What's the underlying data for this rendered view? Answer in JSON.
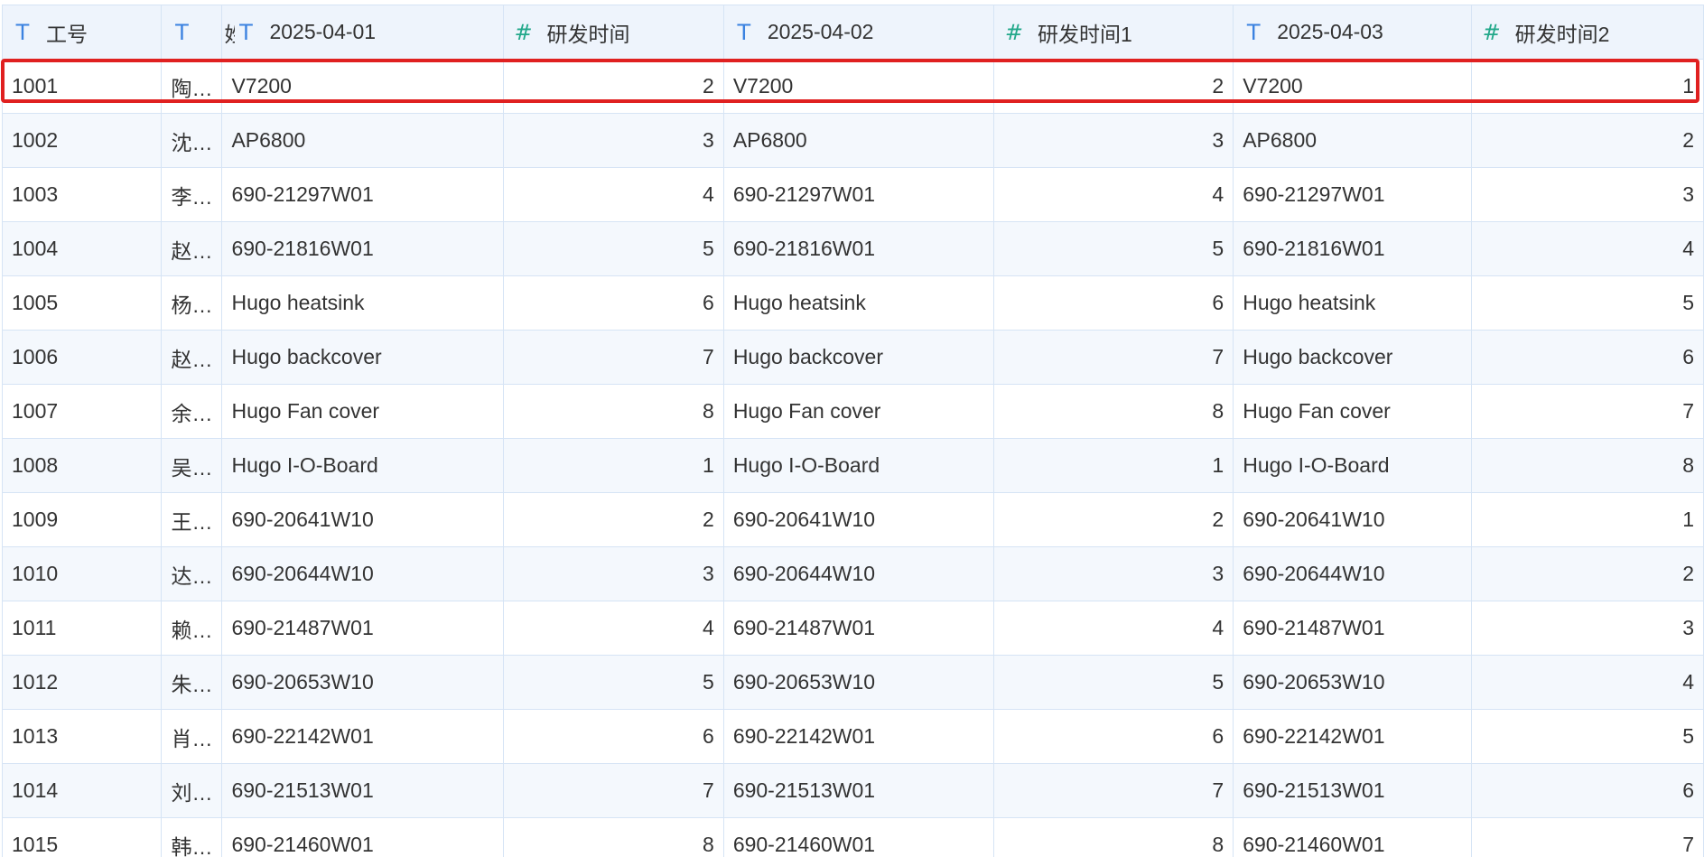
{
  "columns": [
    {
      "icon": "text-type-icon",
      "glyph": "T",
      "label": "工号"
    },
    {
      "icon": "text-type-icon",
      "glyph": "T",
      "label": ""
    },
    {
      "icon": "text-type-icon",
      "glyph": "T",
      "label": "2025-04-01",
      "prefix": "姓"
    },
    {
      "icon": "number-type-icon",
      "glyph": "#",
      "label": "研发时间"
    },
    {
      "icon": "text-type-icon",
      "glyph": "T",
      "label": "2025-04-02"
    },
    {
      "icon": "number-type-icon",
      "glyph": "#",
      "label": "研发时间1"
    },
    {
      "icon": "text-type-icon",
      "glyph": "T",
      "label": "2025-04-03"
    },
    {
      "icon": "number-type-icon",
      "glyph": "#",
      "label": "研发时间2"
    }
  ],
  "rows": [
    [
      "1001",
      "陶…",
      "V7200",
      "2",
      "V7200",
      "2",
      "V7200",
      "1"
    ],
    [
      "1002",
      "沈…",
      "AP6800",
      "3",
      "AP6800",
      "3",
      "AP6800",
      "2"
    ],
    [
      "1003",
      "李…",
      "690-21297W01",
      "4",
      "690-21297W01",
      "4",
      "690-21297W01",
      "3"
    ],
    [
      "1004",
      "赵…",
      "690-21816W01",
      "5",
      "690-21816W01",
      "5",
      "690-21816W01",
      "4"
    ],
    [
      "1005",
      "杨…",
      "Hugo heatsink",
      "6",
      "Hugo heatsink",
      "6",
      "Hugo heatsink",
      "5"
    ],
    [
      "1006",
      "赵…",
      "Hugo backcover",
      "7",
      "Hugo backcover",
      "7",
      "Hugo backcover",
      "6"
    ],
    [
      "1007",
      "余…",
      "Hugo Fan cover",
      "8",
      "Hugo Fan cover",
      "8",
      "Hugo Fan cover",
      "7"
    ],
    [
      "1008",
      "吴…",
      "Hugo I-O-Board",
      "1",
      "Hugo I-O-Board",
      "1",
      "Hugo I-O-Board",
      "8"
    ],
    [
      "1009",
      "王…",
      "690-20641W10",
      "2",
      "690-20641W10",
      "2",
      "690-20641W10",
      "1"
    ],
    [
      "1010",
      "达…",
      "690-20644W10",
      "3",
      "690-20644W10",
      "3",
      "690-20644W10",
      "2"
    ],
    [
      "1011",
      "赖…",
      "690-21487W01",
      "4",
      "690-21487W01",
      "4",
      "690-21487W01",
      "3"
    ],
    [
      "1012",
      "朱…",
      "690-20653W10",
      "5",
      "690-20653W10",
      "5",
      "690-20653W10",
      "4"
    ],
    [
      "1013",
      "肖…",
      "690-22142W01",
      "6",
      "690-22142W01",
      "6",
      "690-22142W01",
      "5"
    ],
    [
      "1014",
      "刘…",
      "690-21513W01",
      "7",
      "690-21513W01",
      "7",
      "690-21513W01",
      "6"
    ],
    [
      "1015",
      "韩…",
      "690-21460W01",
      "8",
      "690-21460W01",
      "8",
      "690-21460W01",
      "7"
    ]
  ],
  "numeric_columns": [
    3,
    5,
    7
  ],
  "selected_row": 0,
  "colors": {
    "text_icon": "#3b82e0",
    "number_icon": "#22a88a",
    "selection": "#e02020",
    "border": "#d6e4f5",
    "header_bg": "#eef4fc"
  }
}
